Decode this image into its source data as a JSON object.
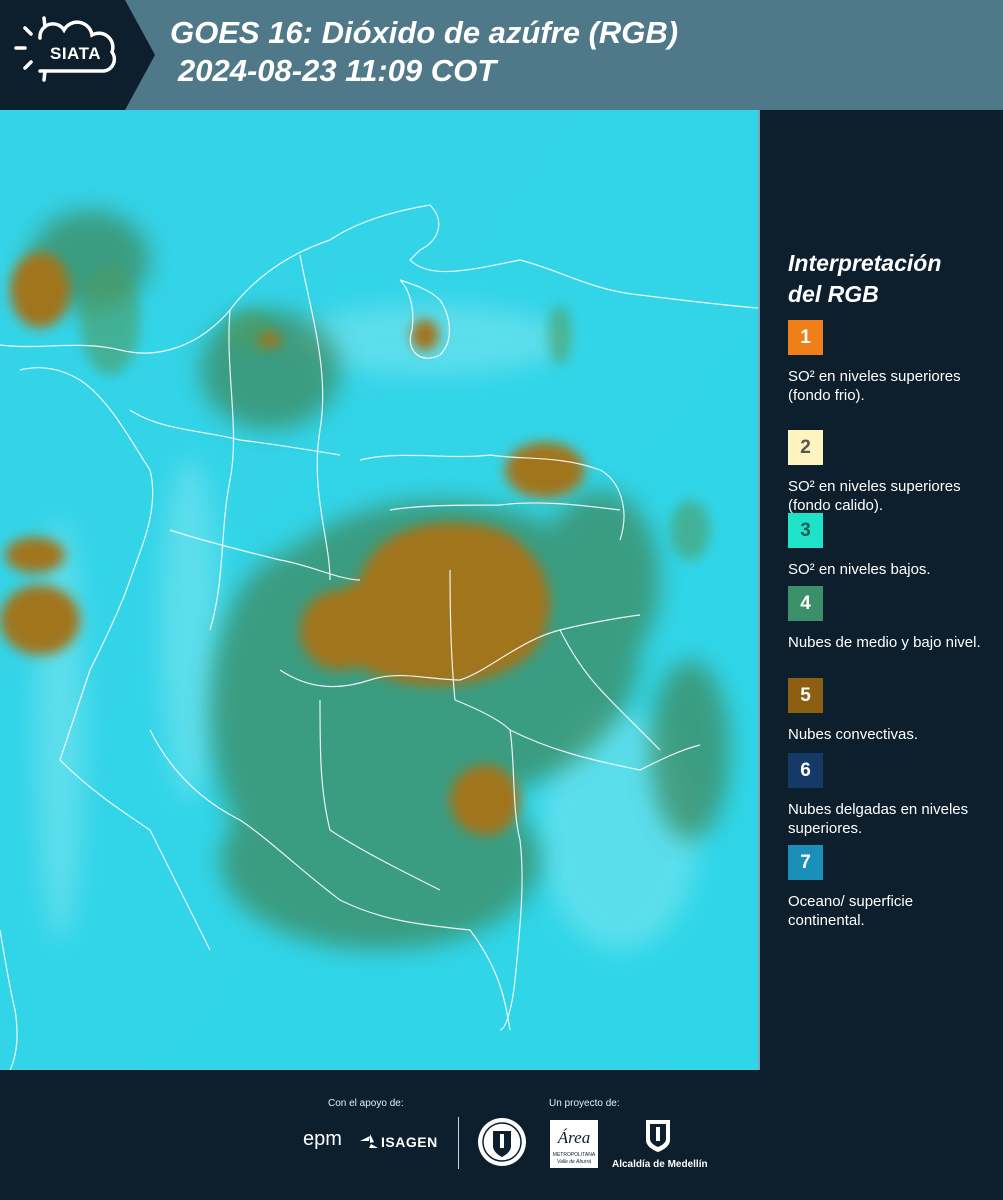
{
  "header": {
    "logo_text": "SIATA",
    "title_line1": "GOES 16: Dióxido de azúfre (RGB)",
    "title_line2": "2024-08-23 11:09 COT"
  },
  "legend": {
    "title_line1": "Interpretación",
    "title_line2": "del RGB",
    "items": [
      {
        "num": "1",
        "color": "#f07f1a",
        "num_color": "#ffffff",
        "text": "SO² en niveles superiores (fondo frio)."
      },
      {
        "num": "2",
        "color": "#fdf4c0",
        "num_color": "#555555",
        "text": "SO² en niveles superiores (fondo calido)."
      },
      {
        "num": "3",
        "color": "#1ee3c8",
        "num_color": "#1f5f56",
        "text": "SO² en niveles bajos."
      },
      {
        "num": "4",
        "color": "#3b8f69",
        "num_color": "#ffffff",
        "text": "Nubes de medio y bajo nivel."
      },
      {
        "num": "5",
        "color": "#8c5f10",
        "num_color": "#ffffff",
        "text": "Nubes convectivas."
      },
      {
        "num": "6",
        "color": "#163a68",
        "num_color": "#ffffff",
        "text": "Nubes delgadas en niveles superiores."
      },
      {
        "num": "7",
        "color": "#1a8fb9",
        "num_color": "#ffffff",
        "text": "Oceano/ superficie continental."
      }
    ]
  },
  "footer": {
    "support_label": "Con el apoyo de:",
    "project_label": "Un proyecto de:",
    "epm": "epm",
    "isagen": "ISAGEN",
    "area_name": "Área",
    "area_sub1": "METROPOLITANA",
    "area_sub2": "Valle de Aburrá",
    "alcaldia": "Alcaldía de Medellín"
  },
  "colors": {
    "header_bg": "#4f7888",
    "page_bg": "#0d1f2d",
    "map_cyan": "#2ed3e6",
    "cloud_brown": "#a1741e",
    "cloud_green": "#3c8a5e"
  }
}
